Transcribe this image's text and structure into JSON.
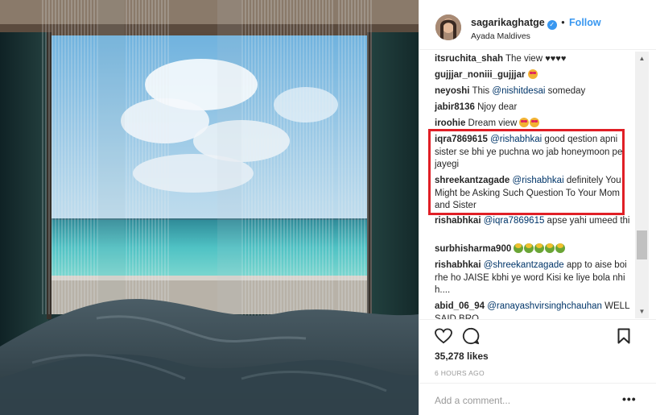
{
  "post": {
    "username": "sagarikaghatge",
    "follow_label": "Follow",
    "location": "Ayada Maldives",
    "likes": "35,278 likes",
    "time_ago": "6 HOURS AGO"
  },
  "comments": [
    {
      "user": "itsruchita_shah",
      "text": " The view",
      "emoji": [
        "heart",
        "heart",
        "heart",
        "heart"
      ]
    },
    {
      "user": "gujjjar_noniii_gujjjar",
      "text": " ",
      "emoji": [
        "star"
      ]
    },
    {
      "user": "neyoshi",
      "text_before": " This ",
      "mention": "@nishitdesai",
      "text_after": " someday"
    },
    {
      "user": "jabir8136",
      "text": " Njoy dear"
    },
    {
      "user": "iroohie",
      "text": " Dream view ",
      "emoji": [
        "star",
        "star"
      ]
    },
    {
      "user": "iqra7869615",
      "mention": "@rishabhkai",
      "text_after": " good qestion apni sister se bhi ye puchna wo jab honeymoon pe jayegi"
    },
    {
      "user": "shreekantzagade",
      "mention": "@rishabhkai",
      "text_after": " definitely You Might be Asking Such Question To Your Mom and Sister"
    },
    {
      "user": "rishabhkai",
      "mention": "@iqra7869615",
      "text_after": " apse yahi umeed thi"
    },
    {
      "user": "surbhisharma900",
      "text": " ",
      "emoji": [
        "rose",
        "rose",
        "rose",
        "rose",
        "rose"
      ]
    },
    {
      "user": "rishabhkai",
      "mention": "@shreekantzagade",
      "text_after": " app to aise boi rhe ho JAISE kbhi ye word Kisi ke liye bola nhi h...."
    },
    {
      "user": "abid_06_94",
      "mention": "@ranayashvirsinghchauhan",
      "text_after": " WELL SAID BRO"
    }
  ],
  "add_comment": {
    "placeholder": "Add a comment..."
  },
  "icons": {
    "like": "heart-icon",
    "comment": "comment-bubble-icon",
    "save": "bookmark-icon",
    "more": "more-options-icon",
    "verified": "verified-badge-icon"
  },
  "colors": {
    "link_blue": "#3897f0",
    "mention_blue": "#003569",
    "highlight_red": "#e01f26",
    "muted_gray": "#999999"
  }
}
